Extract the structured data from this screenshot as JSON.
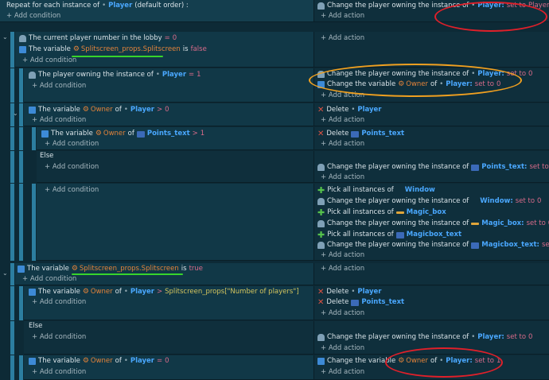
{
  "header": {
    "text": "Repeat for each instance of",
    "object": "Player",
    "suffix": "(default order) :"
  },
  "labels": {
    "add_condition": "+ Add condition",
    "add_action": "+ Add action",
    "else": "Else",
    "dot": "•",
    "change_owner": "Change the player owning the instance of",
    "set_to": "set to",
    "the_variable": "The variable",
    "of": "of",
    "is": "is",
    "delete": "Delete",
    "pick_all": "Pick all instances of",
    "change_var": "Change the variable"
  },
  "objects": {
    "player": "Player:",
    "player_plain": "Player",
    "points_text": "Points_text",
    "points_text_c": "Points_text:",
    "window": "Window",
    "window_c": "Window:",
    "magic_box": "Magic_box",
    "magic_box_c": "Magic_box:",
    "magicbox_text": "Magicbox_text",
    "magicbox_text_c": "Magicbox_text:"
  },
  "vars": {
    "splitscreen": "Splitscreen_props.Splitscreen",
    "owner": "Owner",
    "player_owner": "Player.Owner",
    "num_players": "Splitscreen_props[\"Number of players\"]"
  },
  "values": {
    "zero": "0",
    "one": "1",
    "false": "false",
    "true": "true",
    "eq": "=",
    "gt": ">"
  },
  "rows": {
    "c_lobby": "The current player number in the lobby",
    "c_owning": "The player owning the instance of"
  },
  "colors": {
    "bar": "#2c7ea0",
    "annotation_red": "#e0202a",
    "annotation_orange": "#f0a020",
    "annotation_green": "#37d42c"
  }
}
